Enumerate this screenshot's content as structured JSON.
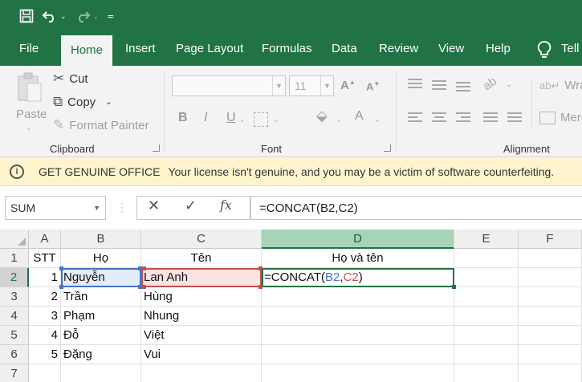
{
  "qat": {
    "save": "save-icon",
    "undo": "undo-icon",
    "redo": "redo-icon",
    "customize": "customize-icon"
  },
  "tabs": [
    "File",
    "Home",
    "Insert",
    "Page Layout",
    "Formulas",
    "Data",
    "Review",
    "View",
    "Help",
    "Tell"
  ],
  "ribbon": {
    "clipboard": {
      "paste": "Paste",
      "cut": "Cut",
      "copy": "Copy",
      "format_painter": "Format Painter",
      "label": "Clipboard"
    },
    "font": {
      "name": "",
      "size": "11",
      "label": "Font",
      "bold": "B",
      "italic": "I",
      "underline": "U"
    },
    "alignment": {
      "wrap": "Wra",
      "merge": "Merg",
      "label": "Alignment"
    }
  },
  "message_bar": {
    "title": "GET GENUINE OFFICE",
    "text": "Your license isn't genuine, and you may be a victim of software counterfeiting."
  },
  "formula_bar": {
    "name_box": "SUM",
    "cancel": "✕",
    "enter": "✓",
    "fx": "fx",
    "formula": "=CONCAT(B2,C2)"
  },
  "grid": {
    "columns": [
      "A",
      "B",
      "C",
      "D",
      "E",
      "F"
    ],
    "rows": [
      "1",
      "2",
      "3",
      "4",
      "5",
      "6",
      "7"
    ],
    "header_row": {
      "A": "STT",
      "B": "Họ",
      "C": "Tên",
      "D": "Họ và tên"
    },
    "data": [
      {
        "stt": "1",
        "ho": "Nguyễn",
        "ten": "Lan Anh"
      },
      {
        "stt": "2",
        "ho": "Trần",
        "ten": "Hùng"
      },
      {
        "stt": "3",
        "ho": "Phạm",
        "ten": "Nhung"
      },
      {
        "stt": "4",
        "ho": "Đỗ",
        "ten": "Việt"
      },
      {
        "stt": "5",
        "ho": "Đặng",
        "ten": "Vui"
      }
    ],
    "editing": {
      "prefix": "=CONCAT(",
      "ref1": "B2",
      "comma": ",",
      "ref2": "C2",
      "suffix": ")"
    }
  }
}
